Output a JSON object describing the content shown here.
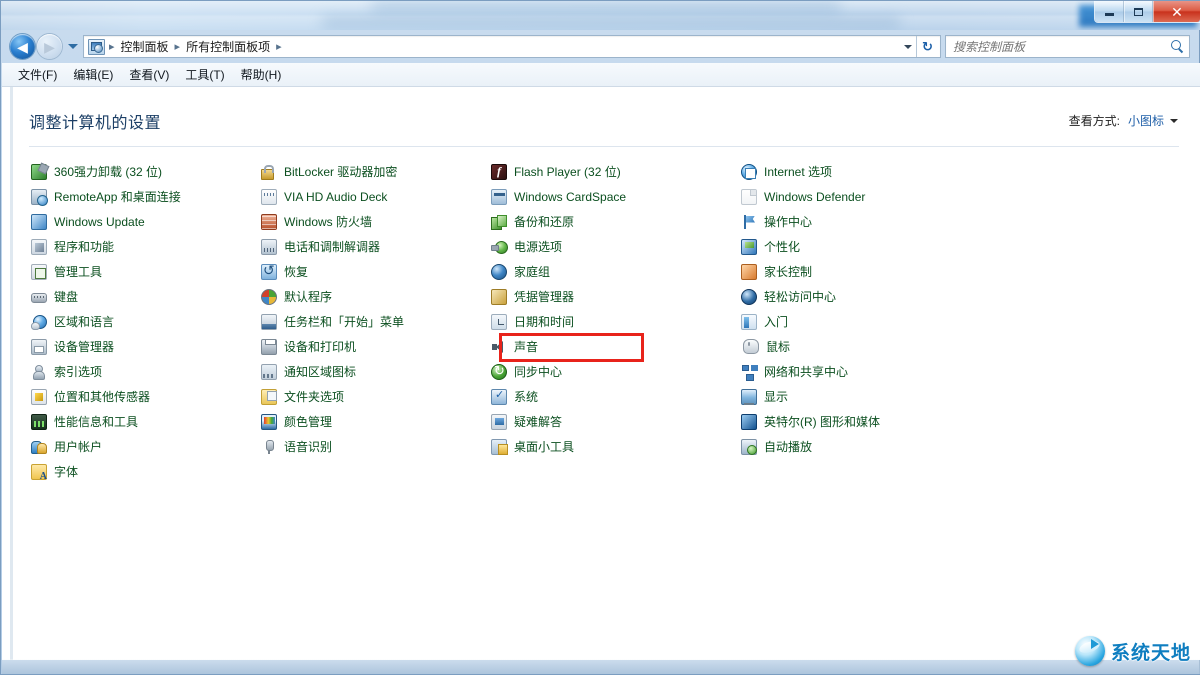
{
  "window": {
    "controls": {
      "minimize_label": "最小化",
      "maximize_label": "最大化",
      "close_label": "✕"
    }
  },
  "nav": {
    "back_label": "◀",
    "forward_label": "▶",
    "recent_pages_label": "最近浏览的页面",
    "refresh_label": "↻",
    "breadcrumbs": [
      {
        "label": "控制面板"
      },
      {
        "label": "所有控制面板项"
      }
    ],
    "separator": "▸"
  },
  "search": {
    "placeholder": "搜索控制面板",
    "value": ""
  },
  "menubar": {
    "items": [
      {
        "label": "文件(F)"
      },
      {
        "label": "编辑(E)"
      },
      {
        "label": "查看(V)"
      },
      {
        "label": "工具(T)"
      },
      {
        "label": "帮助(H)"
      }
    ]
  },
  "header": {
    "title": "调整计算机的设置",
    "view_by_label": "查看方式:",
    "view_by_value": "小图标"
  },
  "columns": [
    {
      "items": [
        {
          "label": "360强力卸载 (32 位)",
          "icon": "uninstall-360-icon"
        },
        {
          "label": "RemoteApp 和桌面连接",
          "icon": "remoteapp-icon"
        },
        {
          "label": "Windows Update",
          "icon": "windows-update-icon"
        },
        {
          "label": "程序和功能",
          "icon": "programs-features-icon"
        },
        {
          "label": "管理工具",
          "icon": "administrative-tools-icon"
        },
        {
          "label": "键盘",
          "icon": "keyboard-icon"
        },
        {
          "label": "区域和语言",
          "icon": "region-language-icon"
        },
        {
          "label": "设备管理器",
          "icon": "device-manager-icon"
        },
        {
          "label": "索引选项",
          "icon": "indexing-options-icon"
        },
        {
          "label": "位置和其他传感器",
          "icon": "location-sensors-icon"
        },
        {
          "label": "性能信息和工具",
          "icon": "performance-info-icon"
        },
        {
          "label": "用户帐户",
          "icon": "user-accounts-icon"
        },
        {
          "label": "字体",
          "icon": "fonts-icon"
        }
      ]
    },
    {
      "items": [
        {
          "label": "BitLocker 驱动器加密",
          "icon": "bitlocker-icon"
        },
        {
          "label": "VIA HD Audio Deck",
          "icon": "via-hd-audio-icon"
        },
        {
          "label": "Windows 防火墙",
          "icon": "windows-firewall-icon"
        },
        {
          "label": "电话和调制解调器",
          "icon": "phone-modem-icon"
        },
        {
          "label": "恢复",
          "icon": "recovery-icon"
        },
        {
          "label": "默认程序",
          "icon": "default-programs-icon"
        },
        {
          "label": "任务栏和「开始」菜单",
          "icon": "taskbar-startmenu-icon"
        },
        {
          "label": "设备和打印机",
          "icon": "devices-printers-icon"
        },
        {
          "label": "通知区域图标",
          "icon": "notification-area-icon"
        },
        {
          "label": "文件夹选项",
          "icon": "folder-options-icon"
        },
        {
          "label": "颜色管理",
          "icon": "color-management-icon"
        },
        {
          "label": "语音识别",
          "icon": "speech-recognition-icon"
        }
      ]
    },
    {
      "items": [
        {
          "label": "Flash Player (32 位)",
          "icon": "flash-player-icon"
        },
        {
          "label": "Windows CardSpace",
          "icon": "windows-cardspace-icon"
        },
        {
          "label": "备份和还原",
          "icon": "backup-restore-icon"
        },
        {
          "label": "电源选项",
          "icon": "power-options-icon",
          "highlighted": true
        },
        {
          "label": "家庭组",
          "icon": "homegroup-icon"
        },
        {
          "label": "凭据管理器",
          "icon": "credential-manager-icon"
        },
        {
          "label": "日期和时间",
          "icon": "date-time-icon"
        },
        {
          "label": "声音",
          "icon": "sound-icon"
        },
        {
          "label": "同步中心",
          "icon": "sync-center-icon"
        },
        {
          "label": "系统",
          "icon": "system-icon"
        },
        {
          "label": "疑难解答",
          "icon": "troubleshooting-icon"
        },
        {
          "label": "桌面小工具",
          "icon": "desktop-gadgets-icon"
        }
      ]
    },
    {
      "items": [
        {
          "label": "Internet 选项",
          "icon": "internet-options-icon"
        },
        {
          "label": "Windows Defender",
          "icon": "windows-defender-icon"
        },
        {
          "label": "操作中心",
          "icon": "action-center-icon"
        },
        {
          "label": "个性化",
          "icon": "personalization-icon"
        },
        {
          "label": "家长控制",
          "icon": "parental-controls-icon"
        },
        {
          "label": "轻松访问中心",
          "icon": "ease-of-access-icon"
        },
        {
          "label": "入门",
          "icon": "getting-started-icon"
        },
        {
          "label": "鼠标",
          "icon": "mouse-icon"
        },
        {
          "label": "网络和共享中心",
          "icon": "network-sharing-icon"
        },
        {
          "label": "显示",
          "icon": "display-icon"
        },
        {
          "label": "英特尔(R) 图形和媒体",
          "icon": "intel-graphics-icon"
        },
        {
          "label": "自动播放",
          "icon": "autoplay-icon"
        }
      ]
    }
  ],
  "watermark": {
    "text": "系统天地"
  },
  "colors": {
    "highlight_red": "#e8231b",
    "link_green": "#0b4f1f",
    "title_blue": "#1c3f66",
    "watermark_blue": "#0f7ec0"
  }
}
